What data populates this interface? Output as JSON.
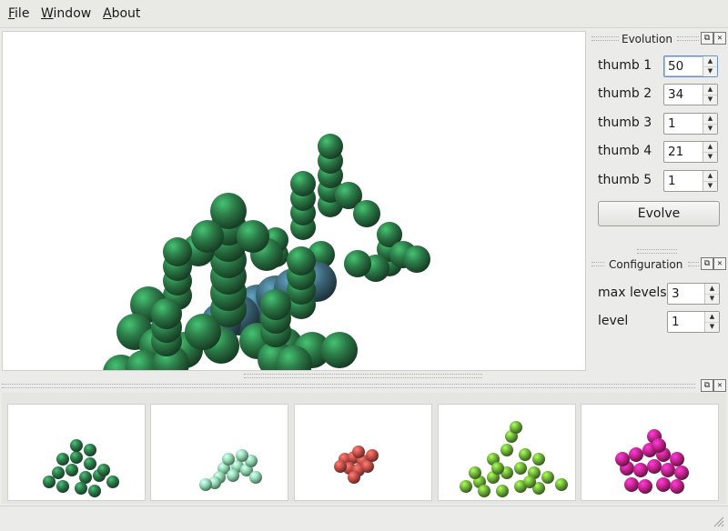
{
  "menu": {
    "file_mn": "F",
    "file_rest": "ile",
    "window_mn": "W",
    "window_rest": "indow",
    "about_mn": "A",
    "about_rest": "bout"
  },
  "evolution": {
    "title": "Evolution",
    "fields": [
      {
        "label": "thumb 1",
        "value": "50"
      },
      {
        "label": "thumb 2",
        "value": "34"
      },
      {
        "label": "thumb 3",
        "value": "1"
      },
      {
        "label": "thumb 4",
        "value": "21"
      },
      {
        "label": "thumb 5",
        "value": "1"
      }
    ],
    "evolve_label": "Evolve"
  },
  "configuration": {
    "title": "Configuration",
    "max_levels_label": "max levels",
    "max_levels_value": "3",
    "level_label": "level",
    "level_value": "1"
  },
  "dock_buttons": {
    "float": "⧉",
    "close": "✕"
  },
  "thumbnails": [
    {
      "name": "thumbnail-1",
      "color": "#2e7a4b"
    },
    {
      "name": "thumbnail-2",
      "color": "#8fd9b0"
    },
    {
      "name": "thumbnail-3",
      "color": "#c8504a"
    },
    {
      "name": "thumbnail-4",
      "color": "#6fb43a"
    },
    {
      "name": "thumbnail-5",
      "color": "#c8258f"
    }
  ],
  "colors": {
    "main_model": "#2c7a48",
    "main_core": "#3d6678"
  }
}
